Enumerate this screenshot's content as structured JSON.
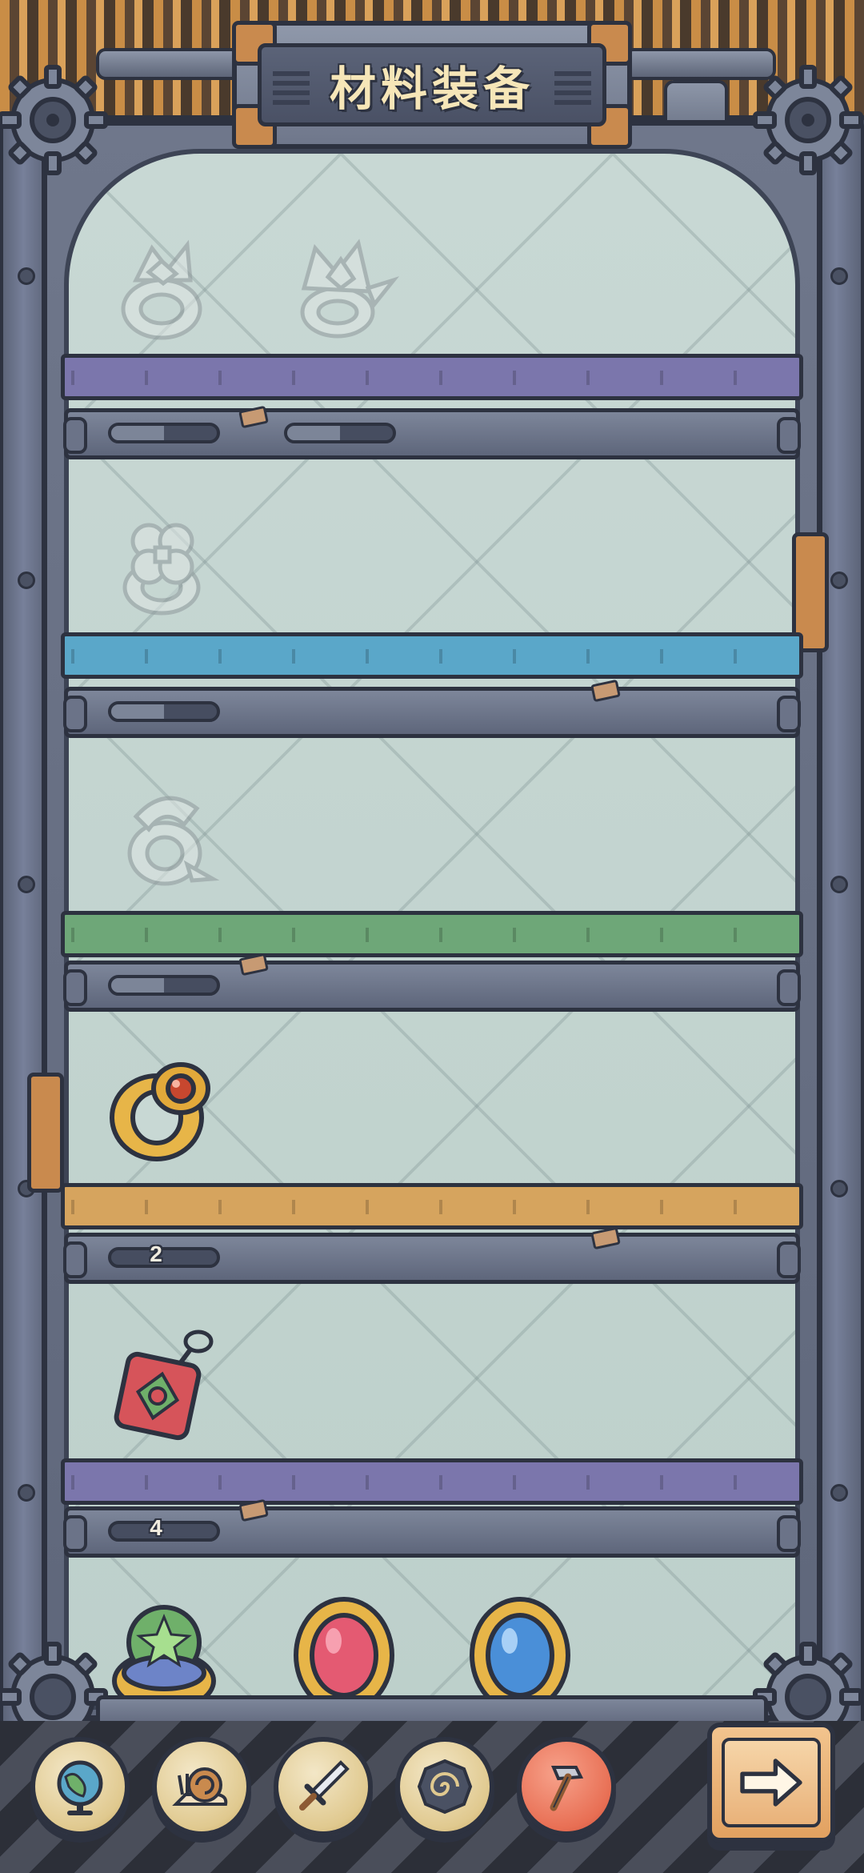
{
  "header": {
    "title": "材料装备"
  },
  "colors": {
    "shelf_1": "#7b76ac",
    "shelf_2": "#5aa7c9",
    "shelf_3": "#6ea778",
    "shelf_4": "#d6a45e",
    "shelf_5": "#7b76ac",
    "frame_dark": "#2d3240",
    "cabinet_glass": "#c8d8d4"
  },
  "shelves": [
    {
      "tier": "purple",
      "items": [
        "spiky-ring-locked",
        "thorn-ring-locked"
      ],
      "count": "",
      "progress": [
        0.5,
        0.5
      ]
    },
    {
      "tier": "blue",
      "items": [
        "clover-ring-locked"
      ],
      "count": "",
      "progress": [
        0.5
      ]
    },
    {
      "tier": "green",
      "items": [
        "claw-ring-locked"
      ],
      "count": "",
      "progress": [
        0.5
      ]
    },
    {
      "tier": "orange",
      "items": [
        "ruby-gold-ring"
      ],
      "count": "2",
      "progress": [
        0
      ]
    },
    {
      "tier": "purple",
      "items": [
        "red-amulet"
      ],
      "count": "4",
      "progress": [
        0
      ]
    },
    {
      "tier": "bottom",
      "items": [
        "star-orb-ring",
        "red-gem-brooch",
        "blue-gem-brooch"
      ]
    }
  ],
  "bottom_nav": [
    {
      "name": "globe",
      "icon": "globe-icon",
      "active": false
    },
    {
      "name": "snail",
      "icon": "snail-icon",
      "active": false
    },
    {
      "name": "sword",
      "icon": "sword-icon",
      "active": false
    },
    {
      "name": "spiral",
      "icon": "spiral-icon",
      "active": false
    },
    {
      "name": "hammer",
      "icon": "hammer-icon",
      "active": true
    }
  ],
  "next_button": {
    "icon": "arrow-right-icon"
  }
}
